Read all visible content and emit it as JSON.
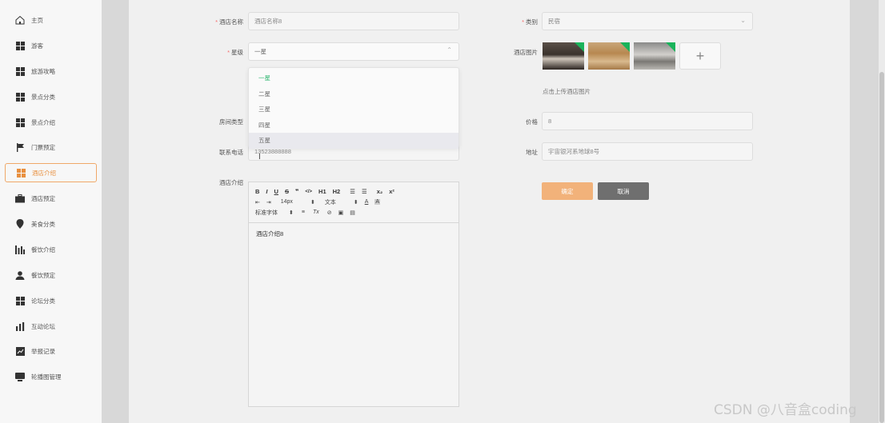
{
  "sidebar": {
    "items": [
      {
        "label": "主页",
        "icon": "home-icon"
      },
      {
        "label": "游客",
        "icon": "grid-icon"
      },
      {
        "label": "旅游攻略",
        "icon": "grid-icon"
      },
      {
        "label": "景点分类",
        "icon": "grid-icon"
      },
      {
        "label": "景点介绍",
        "icon": "grid-icon"
      },
      {
        "label": "门票预定",
        "icon": "flag-icon"
      },
      {
        "label": "酒店介绍",
        "icon": "grid-icon",
        "active": true
      },
      {
        "label": "酒店预定",
        "icon": "briefcase-icon"
      },
      {
        "label": "美食分类",
        "icon": "location-icon"
      },
      {
        "label": "餐饮介绍",
        "icon": "bar-chart-icon"
      },
      {
        "label": "餐饮预定",
        "icon": "user-icon"
      },
      {
        "label": "论坛分类",
        "icon": "grid-icon"
      },
      {
        "label": "互动论坛",
        "icon": "bar-chart-icon"
      },
      {
        "label": "举报记录",
        "icon": "trend-chart-icon"
      },
      {
        "label": "轮播图管理",
        "icon": "monitor-icon"
      }
    ]
  },
  "form": {
    "hotel_name_label": "酒店名称",
    "hotel_name_value": "酒店名称8",
    "category_label": "类别",
    "category_value": "民宿",
    "star_label": "星级",
    "star_value": "一星",
    "star_options": [
      "一星",
      "二星",
      "三星",
      "四星",
      "五星"
    ],
    "images_label": "酒店图片",
    "upload_hint": "点击上传酒店图片",
    "room_type_label": "房间类型",
    "price_label": "价格",
    "price_value": "8",
    "phone_label": "联系电话",
    "phone_value": "13523888888",
    "address_label": "地址",
    "address_value": "宇宙银河系地球8号",
    "intro_label": "酒店介绍",
    "intro_value": "酒店介绍8",
    "required_mark": "*",
    "upload_plus": "+"
  },
  "editor": {
    "row1": [
      "B",
      "I",
      "U",
      "S",
      "❞",
      "</>",
      "H1",
      "H2",
      "☰",
      "☰",
      "x₂",
      "x²"
    ],
    "row2": [
      "⇤",
      "⇥",
      "14px",
      "⬍",
      "文本",
      "⬍",
      "A",
      "A"
    ],
    "row3": [
      "标准字体",
      "⬍",
      "≡",
      "Tx",
      "⊘",
      "▣",
      "▤"
    ]
  },
  "buttons": {
    "ok": "确定",
    "cancel": "取消"
  },
  "watermark": "CSDN @八音盒coding",
  "colors": {
    "accent": "#f2b27a",
    "active_text": "#e89040",
    "selected_option": "#2db56f",
    "required": "#f56c6c"
  }
}
